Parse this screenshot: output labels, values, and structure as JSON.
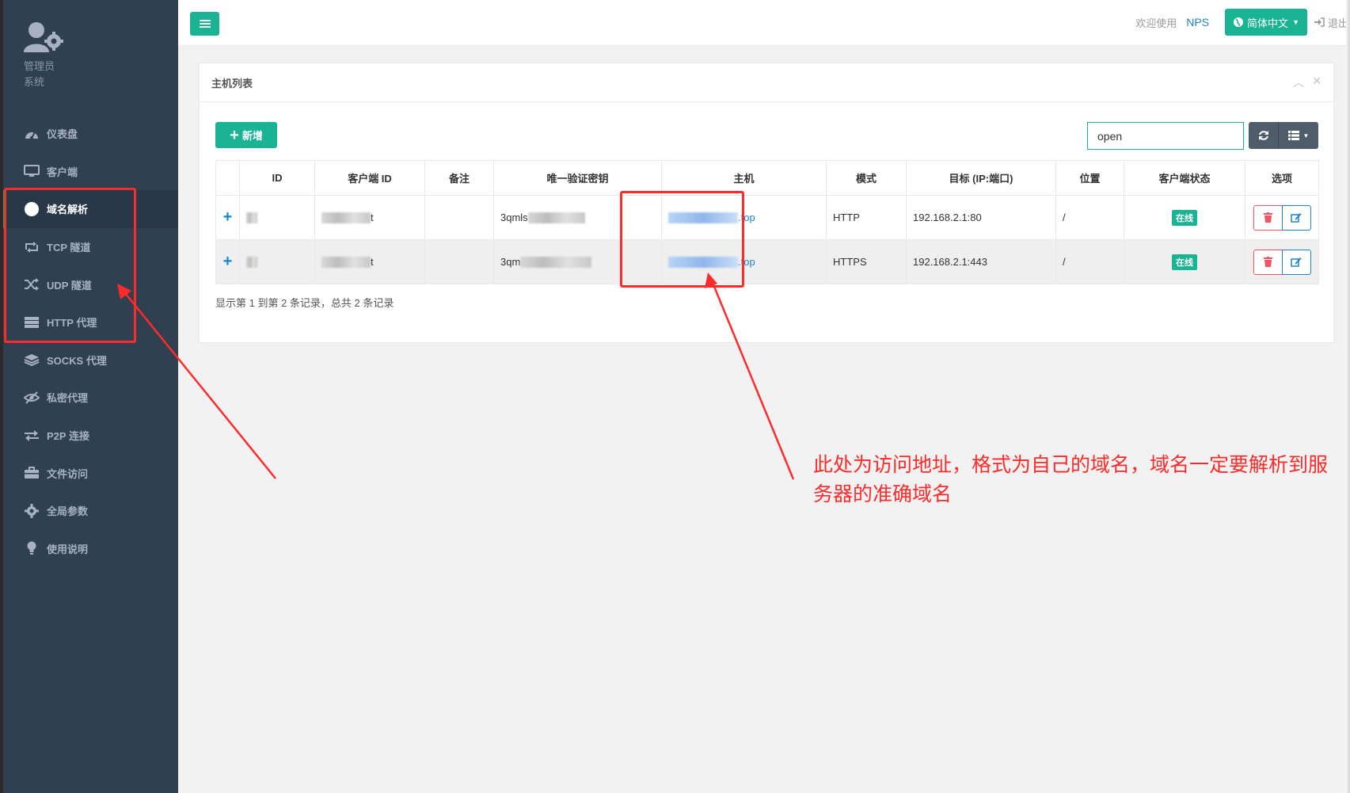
{
  "sidebar": {
    "role_line1": "管理员",
    "role_line2": "系统",
    "items": [
      {
        "label": "仪表盘",
        "icon": "dashboard-icon",
        "active": false
      },
      {
        "label": "客户端",
        "icon": "monitor-icon",
        "active": false
      },
      {
        "label": "域名解析",
        "icon": "globe-icon",
        "active": true
      },
      {
        "label": "TCP 隧道",
        "icon": "retweet-icon",
        "active": false
      },
      {
        "label": "UDP 隧道",
        "icon": "shuffle-icon",
        "active": false
      },
      {
        "label": "HTTP 代理",
        "icon": "server-icon",
        "active": false
      },
      {
        "label": "SOCKS 代理",
        "icon": "layers-icon",
        "active": false
      },
      {
        "label": "私密代理",
        "icon": "eye-slash-icon",
        "active": false
      },
      {
        "label": "P2P 连接",
        "icon": "exchange-icon",
        "active": false
      },
      {
        "label": "文件访问",
        "icon": "briefcase-icon",
        "active": false
      },
      {
        "label": "全局参数",
        "icon": "gear-icon",
        "active": false
      },
      {
        "label": "使用说明",
        "icon": "lightbulb-icon",
        "active": false
      }
    ]
  },
  "topbar": {
    "welcome": "欢迎使用",
    "brand": "NPS",
    "language": "简体中文",
    "logout": "退出"
  },
  "panel": {
    "title": "主机列表",
    "add_label": "新增",
    "search_value": "open"
  },
  "table": {
    "headers": [
      "ID",
      "客户端 ID",
      "备注",
      "唯一验证密钥",
      "主机",
      "模式",
      "目标 (IP:端口)",
      "位置",
      "客户端状态",
      "选项"
    ],
    "rows": [
      {
        "client_suffix": "t",
        "key_prefix": "3qmls",
        "host_suffix": ".top",
        "mode": "HTTP",
        "target": "192.168.2.1:80",
        "location": "/",
        "status": "在线"
      },
      {
        "client_suffix": "t",
        "key_prefix": "3qm",
        "host_suffix": ".top",
        "mode": "HTTPS",
        "target": "192.168.2.1:443",
        "location": "/",
        "status": "在线"
      }
    ],
    "pagination_info": "显示第 1 到第 2 条记录，总共 2 条记录"
  },
  "annotation": {
    "text": "此处为访问地址，格式为自己的域名，域名一定要解析到服务器的准确域名",
    "color": "#ff2a2a"
  },
  "colors": {
    "sidebar_bg": "#2f4050",
    "accent": "#1ab394",
    "link": "#1c84c6",
    "danger": "#ed5565"
  }
}
